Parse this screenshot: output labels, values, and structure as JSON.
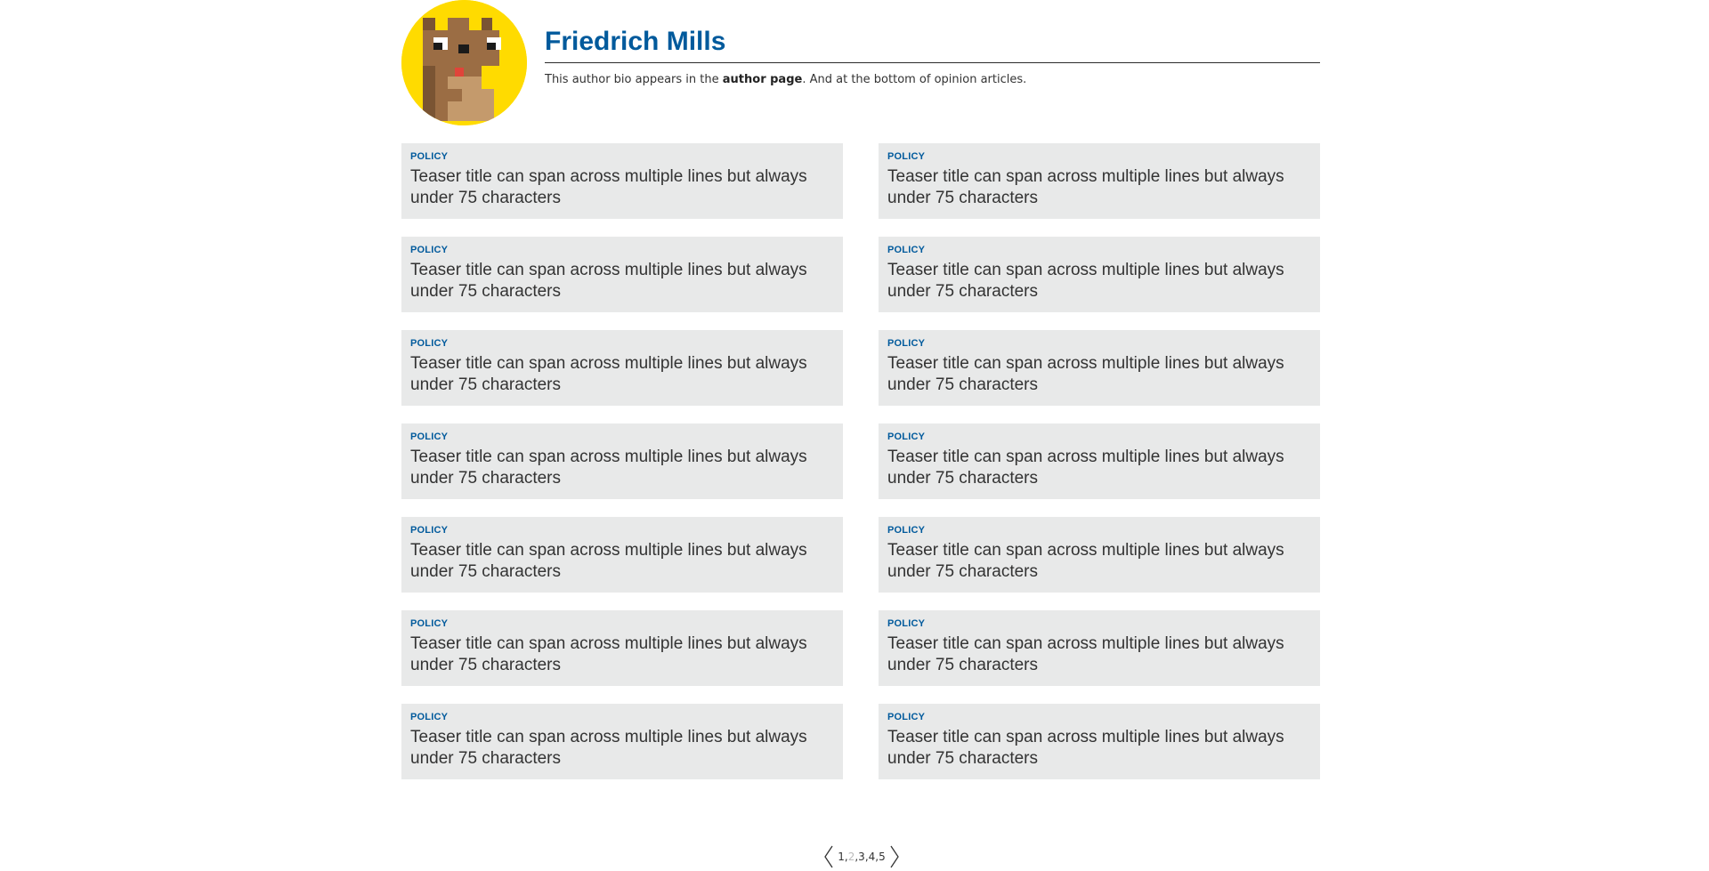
{
  "author": {
    "name": "Friedrich Mills",
    "bio_before": "This author bio appears in the ",
    "bio_link": "author page",
    "bio_after": ". And at the bottom of opinion articles.",
    "avatar_colors": {
      "background": "#ffdb00",
      "fur_dark": "#7a5433",
      "fur_light": "#c49a6c",
      "eye_white": "#ffffff",
      "eye_black": "#1a1a1a",
      "tongue": "#e0443a"
    }
  },
  "teasers": [
    {
      "tag": "Policy",
      "title": "Teaser title can span across multiple lines but always under 75 characters"
    },
    {
      "tag": "Policy",
      "title": "Teaser title can span across multiple lines but always under 75 characters"
    },
    {
      "tag": "Policy",
      "title": "Teaser title can span across multiple lines but always under 75 characters"
    },
    {
      "tag": "Policy",
      "title": "Teaser title can span across multiple lines but always under 75 characters"
    },
    {
      "tag": "Policy",
      "title": "Teaser title can span across multiple lines but always under 75 characters"
    },
    {
      "tag": "Policy",
      "title": "Teaser title can span across multiple lines but always under 75 characters"
    },
    {
      "tag": "Policy",
      "title": "Teaser title can span across multiple lines but always under 75 characters"
    },
    {
      "tag": "Policy",
      "title": "Teaser title can span across multiple lines but always under 75 characters"
    },
    {
      "tag": "Policy",
      "title": "Teaser title can span across multiple lines but always under 75 characters"
    },
    {
      "tag": "Policy",
      "title": "Teaser title can span across multiple lines but always under 75 characters"
    },
    {
      "tag": "Policy",
      "title": "Teaser title can span across multiple lines but always under 75 characters"
    },
    {
      "tag": "Policy",
      "title": "Teaser title can span across multiple lines but always under 75 characters"
    },
    {
      "tag": "Policy",
      "title": "Teaser title can span across multiple lines but always under 75 characters"
    },
    {
      "tag": "Policy",
      "title": "Teaser title can span across multiple lines but always under 75 characters"
    }
  ],
  "pagination": {
    "pages": [
      "1",
      "2",
      "3",
      "4",
      "5"
    ],
    "separator": ",",
    "current": "2",
    "prev_icon": "chevron-left-icon",
    "next_icon": "chevron-right-icon"
  },
  "colors": {
    "accent": "#005a9c",
    "teaser_bg": "#e8e9e9",
    "current_page": "#bbbbbb"
  }
}
